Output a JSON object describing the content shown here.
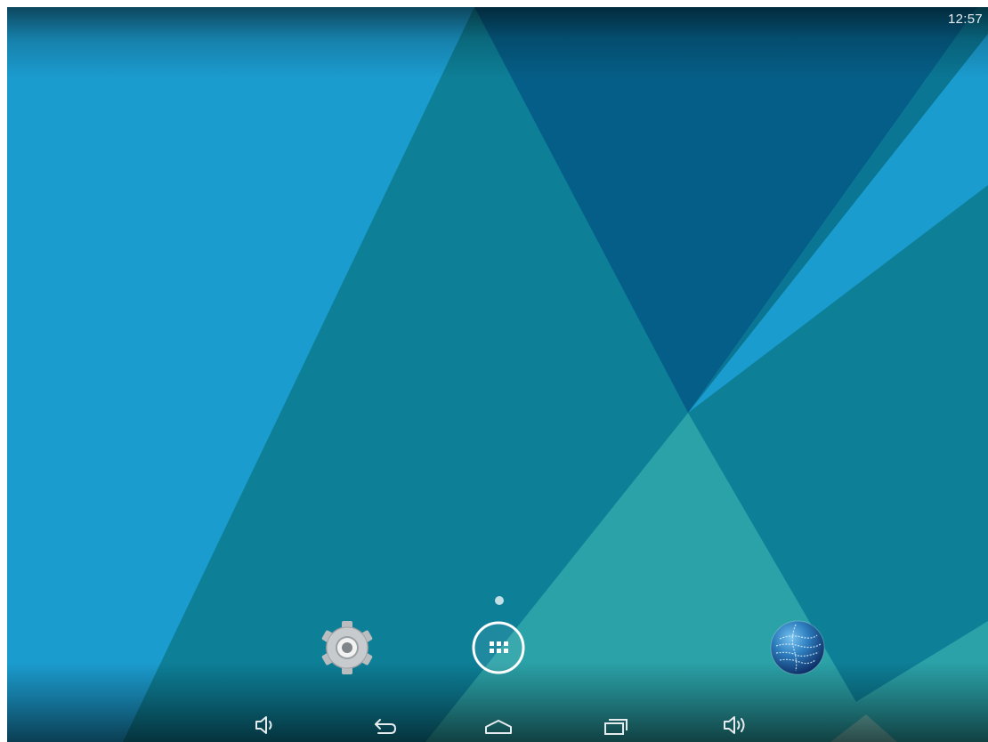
{
  "status_bar": {
    "time": "12:57"
  },
  "home_screen": {
    "page_count": 1,
    "current_page": 1,
    "hotseat": [
      {
        "name": "settings-app",
        "icon": "gear-icon"
      },
      {
        "name": "app-drawer",
        "icon": "app-grid-icon"
      },
      {
        "name": "browser-app",
        "icon": "globe-icon"
      }
    ]
  },
  "navigation_bar": {
    "buttons": [
      {
        "name": "volume-down",
        "icon": "volume-down-icon"
      },
      {
        "name": "back",
        "icon": "back-arrow-icon"
      },
      {
        "name": "home",
        "icon": "home-icon"
      },
      {
        "name": "recents",
        "icon": "recent-apps-icon"
      },
      {
        "name": "volume-up",
        "icon": "volume-up-icon"
      }
    ]
  },
  "colors": {
    "wallpaper_light_blue": "#1b9ccf",
    "wallpaper_teal": "#0d7f97",
    "wallpaper_dark_blue": "#055e87",
    "wallpaper_light_teal": "#2aa2a8",
    "icon_white": "#ffffff"
  }
}
